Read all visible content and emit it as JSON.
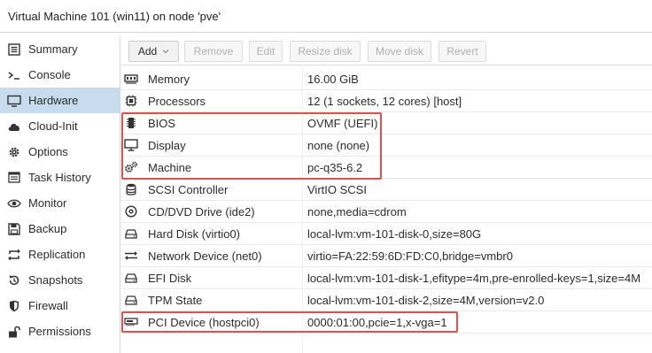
{
  "window": {
    "title": "Virtual Machine 101 (win11) on node 'pve'"
  },
  "sidebar": {
    "items": [
      {
        "label": "Summary",
        "icon": "summary-icon",
        "active": false
      },
      {
        "label": "Console",
        "icon": "console-icon",
        "active": false
      },
      {
        "label": "Hardware",
        "icon": "hardware-icon",
        "active": true
      },
      {
        "label": "Cloud-Init",
        "icon": "cloud-icon",
        "active": false
      },
      {
        "label": "Options",
        "icon": "gear-icon",
        "active": false
      },
      {
        "label": "Task History",
        "icon": "task-history-icon",
        "active": false
      },
      {
        "label": "Monitor",
        "icon": "eye-icon",
        "active": false
      },
      {
        "label": "Backup",
        "icon": "floppy-icon",
        "active": false
      },
      {
        "label": "Replication",
        "icon": "replication-icon",
        "active": false
      },
      {
        "label": "Snapshots",
        "icon": "history-icon",
        "active": false
      },
      {
        "label": "Firewall",
        "icon": "shield-icon",
        "active": false
      },
      {
        "label": "Permissions",
        "icon": "unlock-icon",
        "active": false
      }
    ],
    "active_color": "#c8dcef"
  },
  "toolbar": {
    "add_label": "Add",
    "remove_label": "Remove",
    "edit_label": "Edit",
    "resize_label": "Resize disk",
    "move_label": "Move disk",
    "revert_label": "Revert"
  },
  "hardware": {
    "rows": [
      {
        "name": "Memory",
        "value": "16.00 GiB",
        "icon": "memory-icon"
      },
      {
        "name": "Processors",
        "value": "12 (1 sockets, 12 cores) [host]",
        "icon": "cpu-icon"
      },
      {
        "name": "BIOS",
        "value": "OVMF (UEFI)",
        "icon": "bios-chip-icon"
      },
      {
        "name": "Display",
        "value": "none (none)",
        "icon": "monitor-icon"
      },
      {
        "name": "Machine",
        "value": "pc-q35-6.2",
        "icon": "cogs-icon"
      },
      {
        "name": "SCSI Controller",
        "value": "VirtIO SCSI",
        "icon": "database-icon"
      },
      {
        "name": "CD/DVD Drive (ide2)",
        "value": "none,media=cdrom",
        "icon": "cdrom-icon"
      },
      {
        "name": "Hard Disk (virtio0)",
        "value": "local-lvm:vm-101-disk-0,size=80G",
        "icon": "hdd-icon"
      },
      {
        "name": "Network Device (net0)",
        "value": "virtio=FA:22:59:6D:FD:C0,bridge=vmbr0",
        "icon": "exchange-icon"
      },
      {
        "name": "EFI Disk",
        "value": "local-lvm:vm-101-disk-1,efitype=4m,pre-enrolled-keys=1,size=4M",
        "icon": "hdd-icon"
      },
      {
        "name": "TPM State",
        "value": "local-lvm:vm-101-disk-2,size=4M,version=v2.0",
        "icon": "hdd-icon"
      },
      {
        "name": "PCI Device (hostpci0)",
        "value": "0000:01:00,pcie=1,x-vga=1",
        "icon": "pci-card-icon"
      }
    ]
  },
  "colors": {
    "highlight": "#d9534f",
    "accent": "#c8dcef"
  }
}
